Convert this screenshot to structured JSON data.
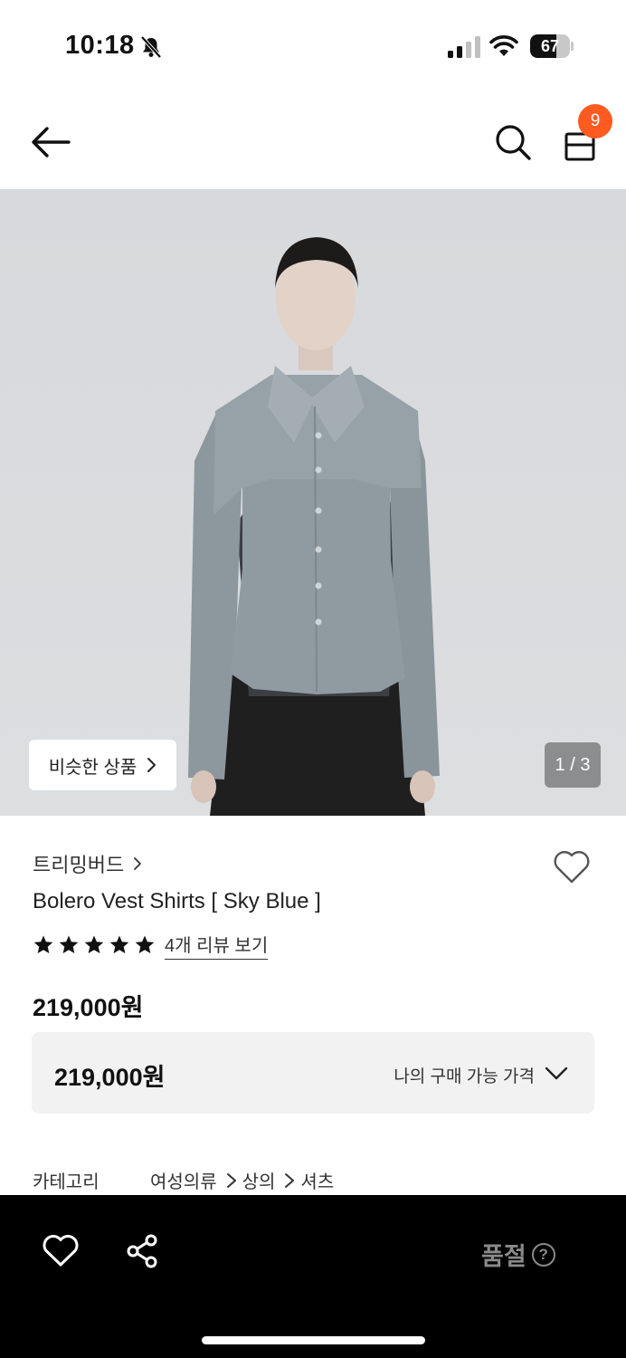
{
  "status_bar": {
    "time": "10:18",
    "battery": "67",
    "battery_level": 0.67,
    "icons": [
      "bell-slash-icon",
      "cellular-signal-icon",
      "wifi-icon",
      "battery-icon"
    ]
  },
  "header": {
    "icons": [
      "arrow-left-icon",
      "search-icon",
      "shopping-bag-icon"
    ],
    "cart_count": "9",
    "badge_color": "#ff5a1f"
  },
  "gallery": {
    "similar_label": "비슷한 상품",
    "page_indicator": "1 / 3",
    "current_page": 1,
    "total_pages": 3
  },
  "product": {
    "brand": "트리밍버드",
    "name": "Bolero Vest Shirts [ Sky Blue ]",
    "rating_stars": 5,
    "review_link": "4개 리뷰 보기",
    "price": "219,000원",
    "price_box": {
      "value": "219,000원",
      "label": "나의 구매 가능 가격"
    },
    "category": {
      "label": "카테고리",
      "path": [
        "여성의류",
        "상의",
        "셔츠"
      ]
    }
  },
  "bottom_bar": {
    "status": "품절",
    "help": "?",
    "icons": [
      "heart-icon",
      "share-icon",
      "question-circle-icon"
    ]
  }
}
